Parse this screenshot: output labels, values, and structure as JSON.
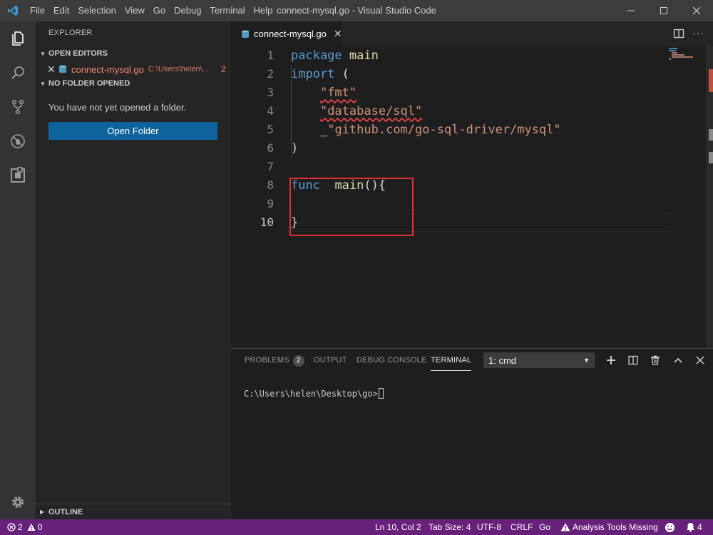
{
  "window": {
    "title": "connect-mysql.go - Visual Studio Code",
    "menu": [
      "File",
      "Edit",
      "Selection",
      "View",
      "Go",
      "Debug",
      "Terminal",
      "Help"
    ]
  },
  "sidebar": {
    "title": "EXPLORER",
    "open_editors_label": "OPEN EDITORS",
    "open_editor": {
      "name": "connect-mysql.go",
      "path": "C:\\Users\\helen\\...",
      "problems": "2"
    },
    "no_folder_label": "NO FOLDER OPENED",
    "no_folder_message": "You have not yet opened a folder.",
    "open_folder_button": "Open Folder",
    "outline_label": "OUTLINE"
  },
  "editor": {
    "tab_label": "connect-mysql.go",
    "line_numbers": [
      "1",
      "2",
      "3",
      "4",
      "5",
      "6",
      "7",
      "8",
      "9",
      "10"
    ],
    "code": {
      "l1_kw": "package",
      "l1_name": "main",
      "l2_kw": "import",
      "l2_paren": "(",
      "l3_str": "\"fmt\"",
      "l4_str": "\"database/sql\"",
      "l5_blank": "_",
      "l5_str": "\"github.com/go-sql-driver/mysql\"",
      "l6_paren": ")",
      "l8_kw": "func",
      "l8_fn": "main",
      "l8_rest": "(){",
      "l10_brace": "}"
    }
  },
  "panel": {
    "tabs": {
      "problems": "PROBLEMS",
      "output": "OUTPUT",
      "debug_console": "DEBUG CONSOLE",
      "terminal": "TERMINAL"
    },
    "problems_count": "2",
    "terminal_select": "1: cmd",
    "terminal_prompt": "C:\\Users\\helen\\Desktop\\go>"
  },
  "statusbar": {
    "errors": "2",
    "warnings": "0",
    "position": "Ln 10, Col 2",
    "tab_size": "Tab Size: 4",
    "encoding": "UTF-8",
    "eol": "CRLF",
    "language": "Go",
    "analysis": "Analysis Tools Missing",
    "notifications": "4"
  },
  "colors": {
    "statusbar": "#68217a",
    "accent_button": "#0e639c",
    "error_text": "#f48771",
    "highlight_box": "#e03131"
  }
}
